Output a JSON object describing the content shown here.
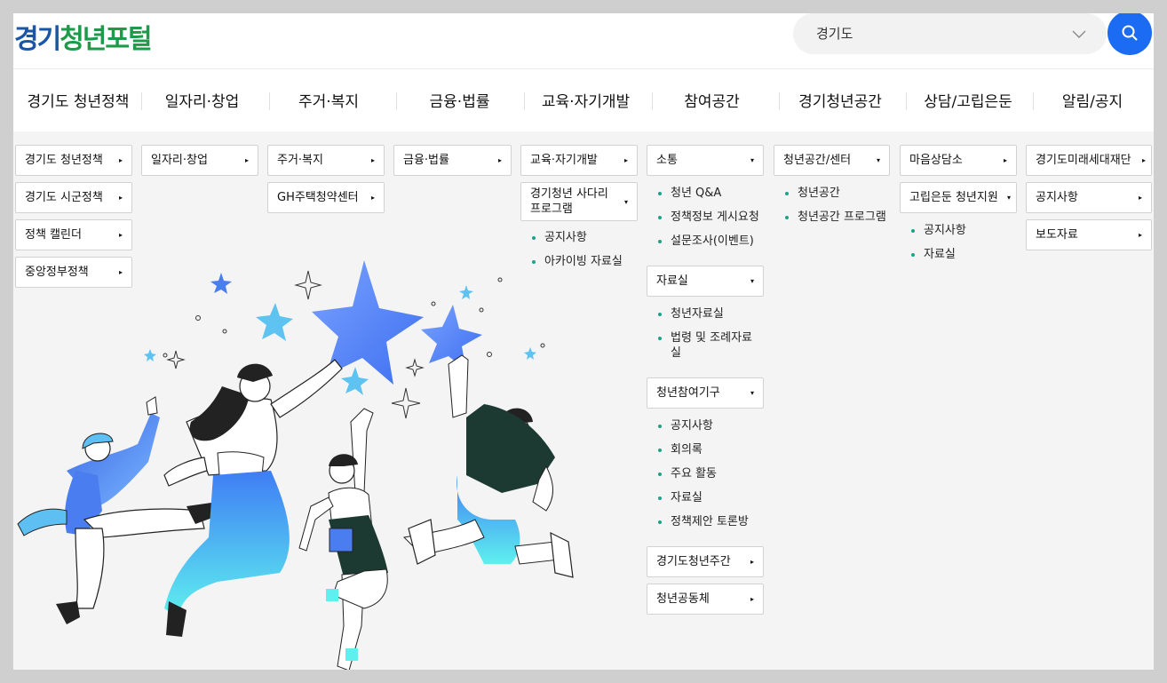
{
  "header": {
    "logo_parts": [
      "경기",
      "청년",
      "포털"
    ],
    "logo_colors": [
      "#1b55a8",
      "#1f9a4a",
      "#1f9a4a"
    ],
    "region_value": "경기도",
    "search_icon": "search-icon",
    "accent": "#1b6cf2"
  },
  "gnb": [
    "경기도 청년정책",
    "일자리·창업",
    "주거·복지",
    "금융·법률",
    "교육·자기개발",
    "참여공간",
    "경기청년공간",
    "상담/고립은둔",
    "알림/공지"
  ],
  "col1": [
    "경기도 청년정책",
    "경기도 시군정책",
    "정책 캘린더",
    "중앙정부정책"
  ],
  "col2": [
    "일자리·창업"
  ],
  "col3": [
    "주거·복지",
    "GH주택청약센터"
  ],
  "col4": [
    "금융·법률"
  ],
  "col5": {
    "btn1": "교육·자기개발",
    "btn2_line1": "경기청년 사다리",
    "btn2_line2": "프로그램",
    "subs": [
      "공지사항",
      "아카이빙 자료실"
    ]
  },
  "col6": {
    "g1": "소통",
    "g1_subs": [
      "청년 Q&A",
      "정책정보 게시요청",
      "설문조사(이벤트)"
    ],
    "g2": "자료실",
    "g2_subs": [
      "청년자료실",
      "법령 및 조례자료",
      "실"
    ],
    "g3": "청년참여기구",
    "g3_subs": [
      "공지사항",
      "회의록",
      "주요 활동",
      "자료실",
      "정책제안 토론방"
    ],
    "g4": "경기도청년주간",
    "g5": "청년공동체"
  },
  "col7": {
    "g1": "청년공간/센터",
    "g1_subs": [
      "청년공간",
      "청년공간 프로그램"
    ]
  },
  "col8": {
    "g1": "마음상담소",
    "g2": "고립은둔 청년지원",
    "g2_subs": [
      "공지사항",
      "자료실"
    ]
  },
  "col9": [
    "경기도미래세대재단",
    "공지사항",
    "보도자료"
  ],
  "icons": {
    "right": "▸",
    "down": "▾"
  }
}
